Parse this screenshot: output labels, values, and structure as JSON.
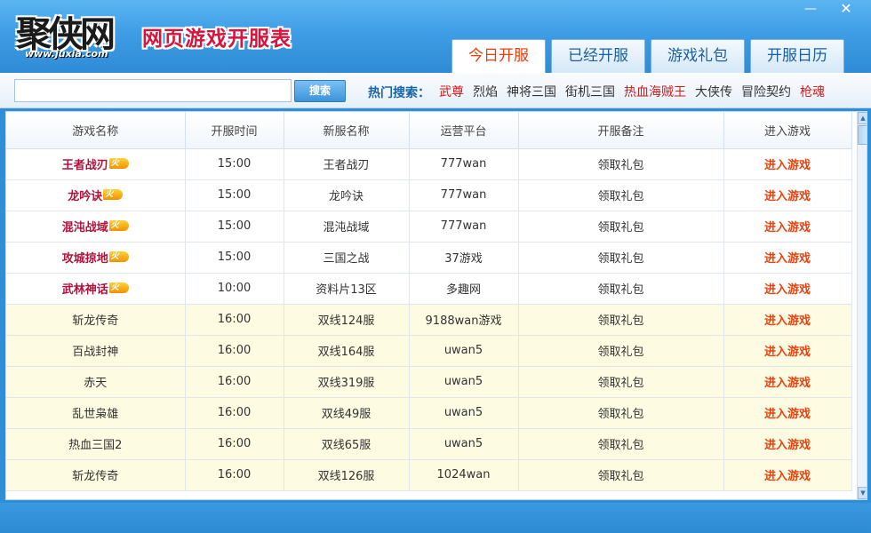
{
  "header": {
    "logo_text": "聚侠网",
    "logo_url": "www.juxia.com",
    "title": "网页游戏开服表",
    "minimize": "—",
    "close": "✕"
  },
  "tabs": [
    {
      "label": "今日开服",
      "active": true
    },
    {
      "label": "已经开服",
      "active": false
    },
    {
      "label": "游戏礼包",
      "active": false
    },
    {
      "label": "开服日历",
      "active": false
    }
  ],
  "search": {
    "placeholder": "",
    "value": "",
    "button_label": "搜索",
    "hot_label": "热门搜索：",
    "hot_links": [
      {
        "label": "武尊",
        "color": "red"
      },
      {
        "label": "烈焰",
        "color": "gray"
      },
      {
        "label": "神将三国",
        "color": "gray"
      },
      {
        "label": "街机三国",
        "color": "gray"
      },
      {
        "label": "热血海贼王",
        "color": "red"
      },
      {
        "label": "大侠传",
        "color": "gray"
      },
      {
        "label": "冒险契约",
        "color": "gray"
      },
      {
        "label": "枪魂",
        "color": "red"
      }
    ]
  },
  "table": {
    "columns": [
      "游戏名称",
      "开服时间",
      "新服名称",
      "运营平台",
      "开服备注",
      "进入游戏"
    ],
    "fire_badge": "火",
    "rows": [
      {
        "name": "王者战刃",
        "time": "15:00",
        "server": "王者战刃",
        "platform": "777wan",
        "note": "领取礼包",
        "action": "进入游戏",
        "hot": true
      },
      {
        "name": "龙吟诀",
        "time": "15:00",
        "server": "龙吟诀",
        "platform": "777wan",
        "note": "领取礼包",
        "action": "进入游戏",
        "hot": true
      },
      {
        "name": "混沌战域",
        "time": "15:00",
        "server": "混沌战域",
        "platform": "777wan",
        "note": "领取礼包",
        "action": "进入游戏",
        "hot": true
      },
      {
        "name": "攻城掠地",
        "time": "15:00",
        "server": "三国之战",
        "platform": "37游戏",
        "note": "领取礼包",
        "action": "进入游戏",
        "hot": true
      },
      {
        "name": "武林神话",
        "time": "10:00",
        "server": "资料片13区",
        "platform": "多趣网",
        "note": "领取礼包",
        "action": "进入游戏",
        "hot": true
      },
      {
        "name": "斩龙传奇",
        "time": "16:00",
        "server": "双线124服",
        "platform": "9188wan游戏",
        "note": "领取礼包",
        "action": "进入游戏",
        "hot": false
      },
      {
        "name": "百战封神",
        "time": "16:00",
        "server": "双线164服",
        "platform": "uwan5",
        "note": "领取礼包",
        "action": "进入游戏",
        "hot": false
      },
      {
        "name": "赤天",
        "time": "16:00",
        "server": "双线319服",
        "platform": "uwan5",
        "note": "领取礼包",
        "action": "进入游戏",
        "hot": false
      },
      {
        "name": "乱世枭雄",
        "time": "16:00",
        "server": "双线49服",
        "platform": "uwan5",
        "note": "领取礼包",
        "action": "进入游戏",
        "hot": false
      },
      {
        "name": "热血三国2",
        "time": "16:00",
        "server": "双线65服",
        "platform": "uwan5",
        "note": "领取礼包",
        "action": "进入游戏",
        "hot": false
      },
      {
        "name": "斩龙传奇",
        "time": "16:00",
        "server": "双线126服",
        "platform": "1024wan",
        "note": "领取礼包",
        "action": "进入游戏",
        "hot": false
      }
    ]
  },
  "colors": {
    "accent": "#2f8bd6",
    "hot_name": "#b0123c",
    "enter": "#e8420e",
    "normal_row": "#fdfbe2"
  }
}
